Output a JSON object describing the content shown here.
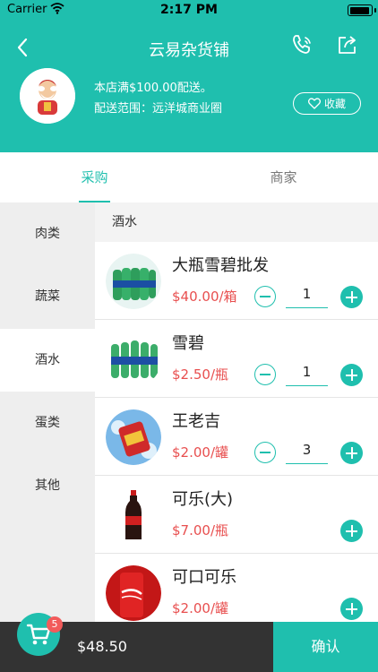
{
  "status": {
    "carrier": "Carrier",
    "time": "2:17 PM",
    "battery_level": 0.95
  },
  "header": {
    "title": "云易杂货铺",
    "delivery_min": "本店满$100.00配送。",
    "delivery_range": "配送范围：远洋城商业圈",
    "favorite_label": "收藏"
  },
  "tabs": [
    {
      "label": "采购",
      "active": true
    },
    {
      "label": "商家",
      "active": false
    }
  ],
  "categories": [
    {
      "label": "肉类"
    },
    {
      "label": "蔬菜"
    },
    {
      "label": "酒水",
      "active": true
    },
    {
      "label": "蛋类"
    },
    {
      "label": "其他"
    }
  ],
  "list": {
    "section_title": "酒水",
    "items": [
      {
        "name": "大瓶雪碧批发",
        "price": "$40.00/箱",
        "qty": "1"
      },
      {
        "name": "雪碧",
        "price": "$2.50/瓶",
        "qty": "1"
      },
      {
        "name": "王老吉",
        "price": "$2.00/罐",
        "qty": "3"
      },
      {
        "name": "可乐(大)",
        "price": "$7.00/瓶",
        "qty": ""
      },
      {
        "name": "可口可乐",
        "price": "$2.00/罐",
        "qty": ""
      }
    ]
  },
  "cart": {
    "count": "5",
    "total": "$48.50",
    "confirm_label": "确认"
  },
  "colors": {
    "accent": "#1fbfae",
    "price": "#e84f4f",
    "badge": "#f25b5b",
    "bottom_bar": "#333333"
  }
}
